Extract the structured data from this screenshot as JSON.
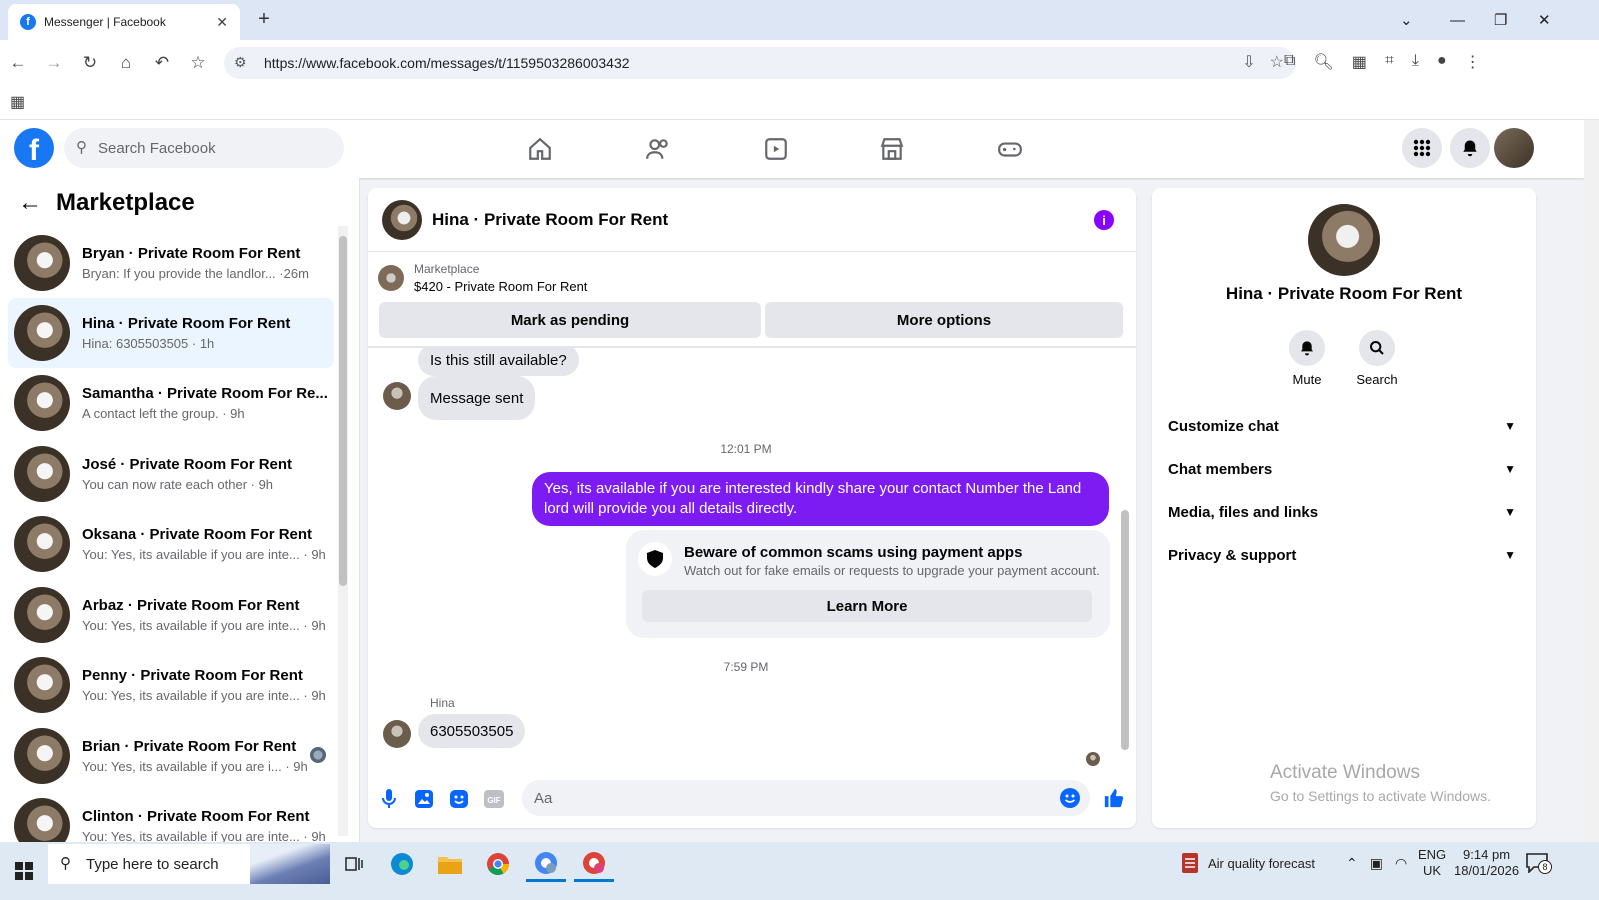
{
  "browser": {
    "tab_title": "Messenger | Facebook",
    "url": "https://www.facebook.com/messages/t/1159503286003432"
  },
  "facebook": {
    "search_placeholder": "Search Facebook"
  },
  "sidebar": {
    "title": "Marketplace",
    "conversations": [
      {
        "name": "Bryan · Private Room For Rent",
        "preview": "Bryan: If you provide the landlor... ·26m"
      },
      {
        "name": "Hina · Private Room For Rent",
        "preview": "Hina: 6305503505 · 1h"
      },
      {
        "name": "Samantha · Private Room For Re...",
        "preview": "A contact left the group. · 9h"
      },
      {
        "name": "José · Private Room For Rent",
        "preview": "You can now rate each other · 9h"
      },
      {
        "name": "Oksana · Private Room For Rent",
        "preview": "You: Yes, its available if you are inte... · 9h"
      },
      {
        "name": "Arbaz · Private Room For Rent",
        "preview": "You: Yes, its available if you are inte... · 9h"
      },
      {
        "name": "Penny · Private Room For Rent",
        "preview": "You: Yes, its available if you are inte... · 9h"
      },
      {
        "name": "Brian · Private Room For Rent",
        "preview": "You: Yes, its available if you are i... · 9h"
      },
      {
        "name": "Clinton · Private Room For Rent",
        "preview": "You: Yes, its available if you are inte... · 9h"
      }
    ]
  },
  "chat": {
    "title": "Hina · Private Room For Rent",
    "marketplace_label": "Marketplace",
    "listing": "$420 - Private Room For Rent",
    "mark_pending": "Mark as pending",
    "more_options": "More options",
    "msg_available": "Is this still available?",
    "msg_sent": "Message sent",
    "time1": "12:01 PM",
    "msg_out": "Yes, its available if you are interested kindly share your contact Number the Land lord will provide you all details directly.",
    "warn_title": "Beware of common scams using payment apps",
    "warn_sub": "Watch out for fake emails or requests to upgrade your payment account.",
    "learn_more": "Learn More",
    "time2": "7:59 PM",
    "sender": "Hina",
    "msg_number": "6305503505",
    "input_placeholder": "Aa"
  },
  "details": {
    "name": "Hina · Private Room For Rent",
    "mute": "Mute",
    "search": "Search",
    "sections": [
      "Customize chat",
      "Chat members",
      "Media, files and links",
      "Privacy & support"
    ]
  },
  "watermark": {
    "line1": "Activate Windows",
    "line2": "Go to Settings to activate Windows."
  },
  "taskbar": {
    "search_placeholder": "Type here to search",
    "weather": "Air quality forecast",
    "lang1": "ENG",
    "lang2": "UK",
    "time": "9:14 pm",
    "date": "18/01/2026",
    "notif_count": "8"
  },
  "colors": {
    "brand": "#1877f2",
    "outgoing_bubble": "#7c1cf2"
  }
}
